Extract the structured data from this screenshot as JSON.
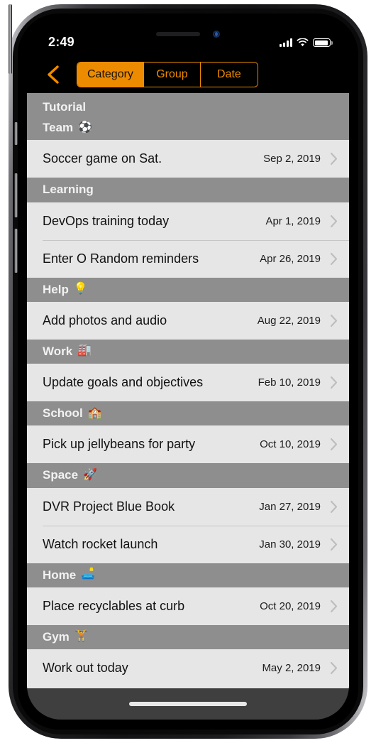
{
  "status_bar": {
    "time": "2:49",
    "signal_icon": "cellular-signal-icon",
    "wifi_icon": "wifi-icon",
    "battery_icon": "battery-icon"
  },
  "nav_bar": {
    "back_icon": "back-chevron-icon",
    "segments": [
      {
        "label": "Category",
        "selected": true
      },
      {
        "label": "Group",
        "selected": false
      },
      {
        "label": "Date",
        "selected": false
      }
    ]
  },
  "list": {
    "title": "Tutorial",
    "sections": [
      {
        "name": "Team",
        "emoji": "⚽",
        "items": [
          {
            "title": "Soccer game on Sat.",
            "date": "Sep 2, 2019"
          }
        ]
      },
      {
        "name": "Learning",
        "emoji": "",
        "items": [
          {
            "title": "DevOps training today",
            "date": "Apr 1, 2019"
          },
          {
            "title": "Enter O Random reminders",
            "date": "Apr 26, 2019"
          }
        ]
      },
      {
        "name": "Help",
        "emoji": "💡",
        "items": [
          {
            "title": "Add photos and audio",
            "date": "Aug 22, 2019"
          }
        ]
      },
      {
        "name": "Work",
        "emoji": "🏭",
        "items": [
          {
            "title": "Update goals and objectives",
            "date": "Feb 10, 2019"
          }
        ]
      },
      {
        "name": "School",
        "emoji": "🏫",
        "items": [
          {
            "title": "Pick up jellybeans for party",
            "date": "Oct 10, 2019"
          }
        ]
      },
      {
        "name": "Space",
        "emoji": "🚀",
        "items": [
          {
            "title": "DVR Project Blue Book",
            "date": "Jan 27, 2019"
          },
          {
            "title": "Watch rocket launch",
            "date": "Jan 30, 2019"
          }
        ]
      },
      {
        "name": "Home",
        "emoji": "🛋️",
        "items": [
          {
            "title": "Place recyclables at curb",
            "date": "Oct 20, 2019"
          }
        ]
      },
      {
        "name": "Gym",
        "emoji": "🏋️",
        "items": [
          {
            "title": "Work out today",
            "date": "May 2, 2019"
          }
        ]
      }
    ]
  },
  "home_indicator": "home-indicator",
  "colors": {
    "accent": "#ED8B00",
    "section_header_bg": "#8E8E8E",
    "row_bg": "#E6E6E6",
    "nav_bg": "#000000",
    "home_bar_bg": "#3F3F3F"
  }
}
